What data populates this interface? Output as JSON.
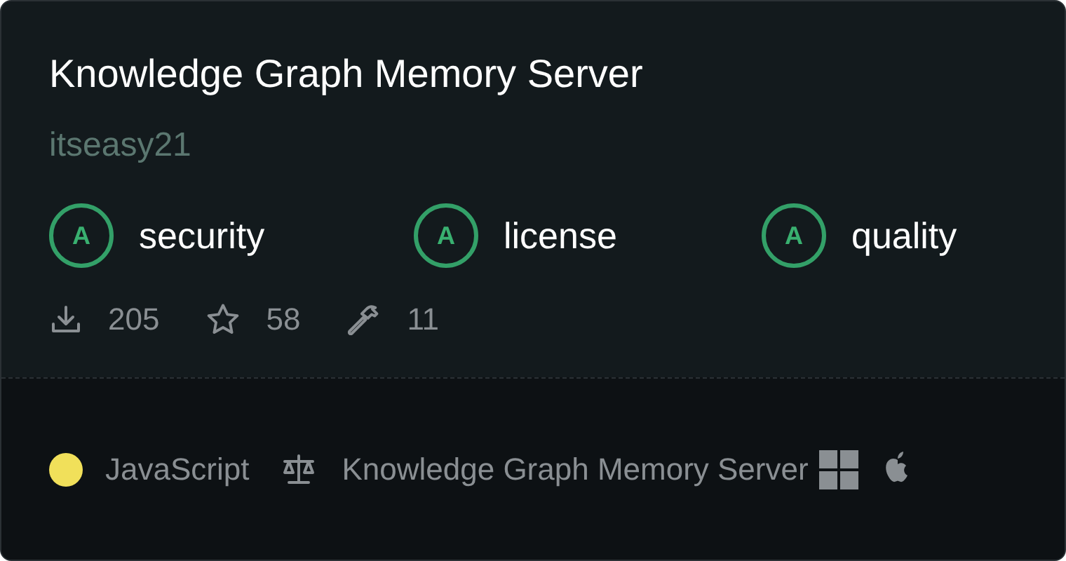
{
  "title": "Knowledge Graph Memory Server",
  "author": "itseasy21",
  "scores": [
    {
      "grade": "A",
      "label": "security"
    },
    {
      "grade": "A",
      "label": "license"
    },
    {
      "grade": "A",
      "label": "quality"
    }
  ],
  "stats": {
    "downloads": "205",
    "stars": "58",
    "tools": "11"
  },
  "footer": {
    "language": {
      "name": "JavaScript",
      "color": "#f1e05a"
    },
    "license": "Knowledge Graph Memory Server"
  }
}
